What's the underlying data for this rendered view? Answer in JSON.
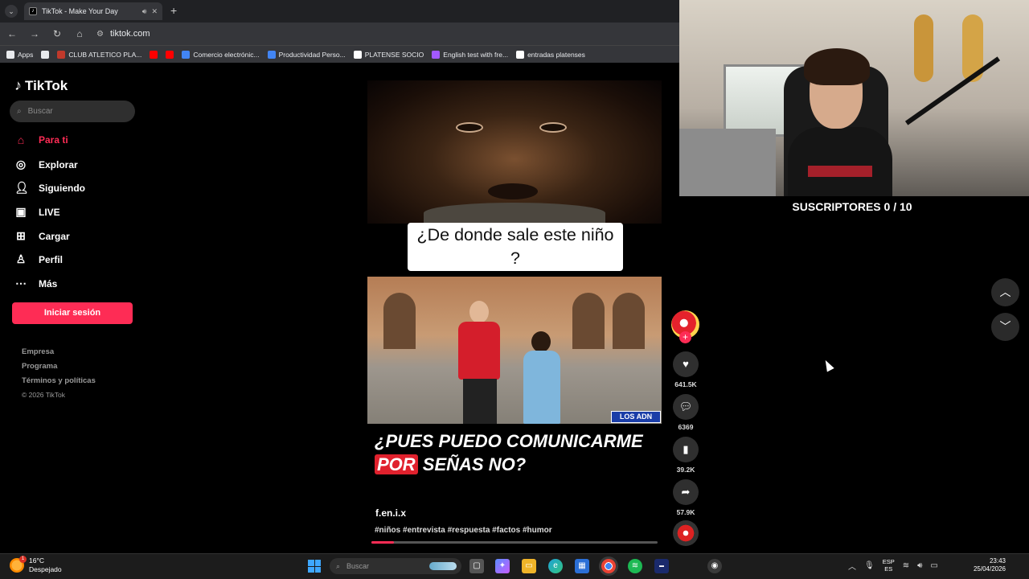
{
  "browser": {
    "tab_title": "TikTok - Make Your Day",
    "url": "tiktok.com",
    "bookmarks": [
      {
        "label": "Apps",
        "color": "#e8eaed"
      },
      {
        "label": "",
        "color": "#e8eaed"
      },
      {
        "label": "CLUB ATLETICO PLA...",
        "color": "#c0392b"
      },
      {
        "label": "",
        "color": "#ff0000"
      },
      {
        "label": "",
        "color": "#ff0000"
      },
      {
        "label": "Comercio electrónic...",
        "color": "#4285f4"
      },
      {
        "label": "Productividad Perso...",
        "color": "#4285f4"
      },
      {
        "label": "PLATENSE SOCIO",
        "color": "#ffffff"
      },
      {
        "label": "English test with fre...",
        "color": "#a259ff"
      },
      {
        "label": "entradas platenses",
        "color": "#ffffff"
      }
    ]
  },
  "tiktok": {
    "logo": "TikTok",
    "search_placeholder": "Buscar",
    "nav": [
      {
        "label": "Para ti",
        "icon": "home-icon"
      },
      {
        "label": "Explorar",
        "icon": "compass-icon"
      },
      {
        "label": "Siguiendo",
        "icon": "following-icon"
      },
      {
        "label": "LIVE",
        "icon": "live-icon"
      },
      {
        "label": "Cargar",
        "icon": "upload-icon"
      },
      {
        "label": "Perfil",
        "icon": "profile-icon"
      },
      {
        "label": "Más",
        "icon": "more-icon"
      }
    ],
    "login": "Iniciar sesión",
    "footer": [
      "Empresa",
      "Programa",
      "Términos y políticas",
      "© 2026 TikTok"
    ],
    "accent": "#fe2c55"
  },
  "video": {
    "question_caption": "¿De donde sale este niño ?",
    "badge": "LOS ADN",
    "big_caption_line1": "¿PUES PUEDO COMUNICARME",
    "big_caption_highlight": "POR",
    "big_caption_rest": " SEÑAS NO?",
    "author": "f.en.i.x",
    "hashtags": "#niños #entrevista #respuesta #factos #humor",
    "progress_fraction": 0.08,
    "likes": "641.5K",
    "comments": "6369",
    "saves": "39.2K",
    "shares": "57.9K"
  },
  "stream": {
    "subscribers": "SUSCRIPTORES 0 / 10"
  },
  "taskbar": {
    "temperature": "16°C",
    "weather": "Despejado",
    "weather_alert": "1",
    "search_placeholder": "Buscar",
    "lang_top": "ESP",
    "lang_bottom": "ES",
    "time": "23:43",
    "date": "25/04/2026"
  }
}
